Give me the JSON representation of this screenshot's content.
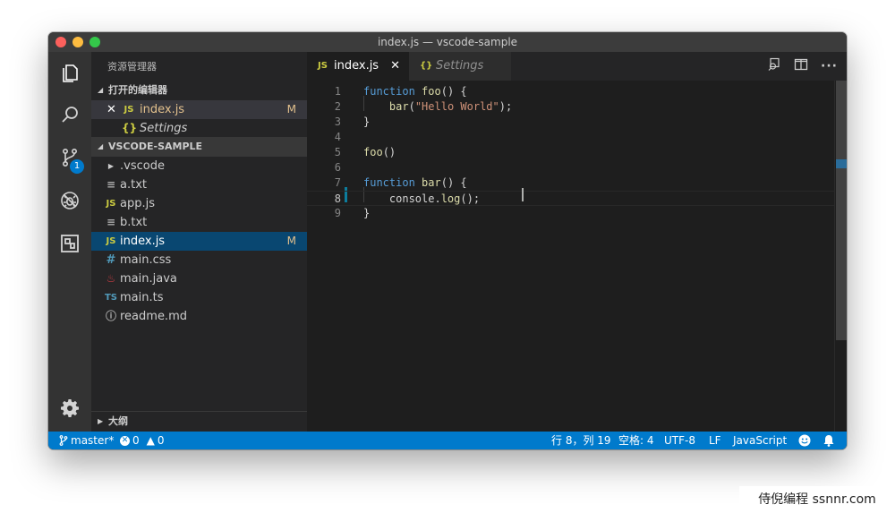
{
  "window": {
    "title": "index.js — vscode-sample"
  },
  "activity_bar": {
    "items": [
      "explorer",
      "search",
      "source-control",
      "debug",
      "extensions"
    ],
    "scm_badge": "1"
  },
  "sidebar": {
    "title": "资源管理器",
    "open_editors": {
      "header": "打开的编辑器",
      "items": [
        {
          "icon": "JS",
          "name": "index.js",
          "status": "M"
        },
        {
          "icon": "{}",
          "name": "Settings",
          "status": ""
        }
      ]
    },
    "project": {
      "header": "VSCODE-SAMPLE",
      "items": [
        {
          "icon": "folder",
          "name": ".vscode",
          "status": ""
        },
        {
          "icon": "text",
          "name": "a.txt",
          "status": ""
        },
        {
          "icon": "JS",
          "name": "app.js",
          "status": ""
        },
        {
          "icon": "text",
          "name": "b.txt",
          "status": ""
        },
        {
          "icon": "JS",
          "name": "index.js",
          "status": "M"
        },
        {
          "icon": "#",
          "name": "main.css",
          "status": ""
        },
        {
          "icon": "java",
          "name": "main.java",
          "status": ""
        },
        {
          "icon": "TS",
          "name": "main.ts",
          "status": ""
        },
        {
          "icon": "info",
          "name": "readme.md",
          "status": ""
        }
      ]
    },
    "outline": {
      "header": "大纲"
    }
  },
  "tabs": [
    {
      "icon": "JS",
      "label": "index.js",
      "active": true
    },
    {
      "icon": "{}",
      "label": "Settings",
      "active": false
    }
  ],
  "editor": {
    "lines": [
      {
        "n": "1",
        "tokens": [
          [
            "kw",
            "function "
          ],
          [
            "fn",
            "foo"
          ],
          [
            "plain",
            "() {"
          ]
        ]
      },
      {
        "n": "2",
        "tokens": [
          [
            "plain",
            "    "
          ],
          [
            "fn",
            "bar"
          ],
          [
            "plain",
            "("
          ],
          [
            "str",
            "\"Hello World\""
          ],
          [
            "plain",
            ");"
          ]
        ]
      },
      {
        "n": "3",
        "tokens": [
          [
            "plain",
            "}"
          ]
        ]
      },
      {
        "n": "4",
        "tokens": []
      },
      {
        "n": "5",
        "tokens": [
          [
            "fn",
            "foo"
          ],
          [
            "plain",
            "()"
          ]
        ]
      },
      {
        "n": "6",
        "tokens": []
      },
      {
        "n": "7",
        "tokens": [
          [
            "kw",
            "function "
          ],
          [
            "fn",
            "bar"
          ],
          [
            "plain",
            "() {"
          ]
        ]
      },
      {
        "n": "8",
        "tokens": [
          [
            "plain",
            "    console."
          ],
          [
            "fn",
            "log"
          ],
          [
            "plain",
            "();"
          ]
        ]
      },
      {
        "n": "9",
        "tokens": [
          [
            "plain",
            "}"
          ]
        ]
      }
    ],
    "current_line": "8"
  },
  "status_bar": {
    "branch": "master*",
    "errors": "0",
    "warnings": "0",
    "position": "行 8，列 19",
    "indent": "空格: 4",
    "encoding": "UTF-8",
    "eol": "LF",
    "language": "JavaScript"
  },
  "watermark": "侍倪编程 ssnnr.com",
  "colors": {
    "accent": "#007acc",
    "modified": "#e2c08d",
    "keyword": "#569cd6",
    "function": "#dcdcaa",
    "string": "#ce9178"
  }
}
